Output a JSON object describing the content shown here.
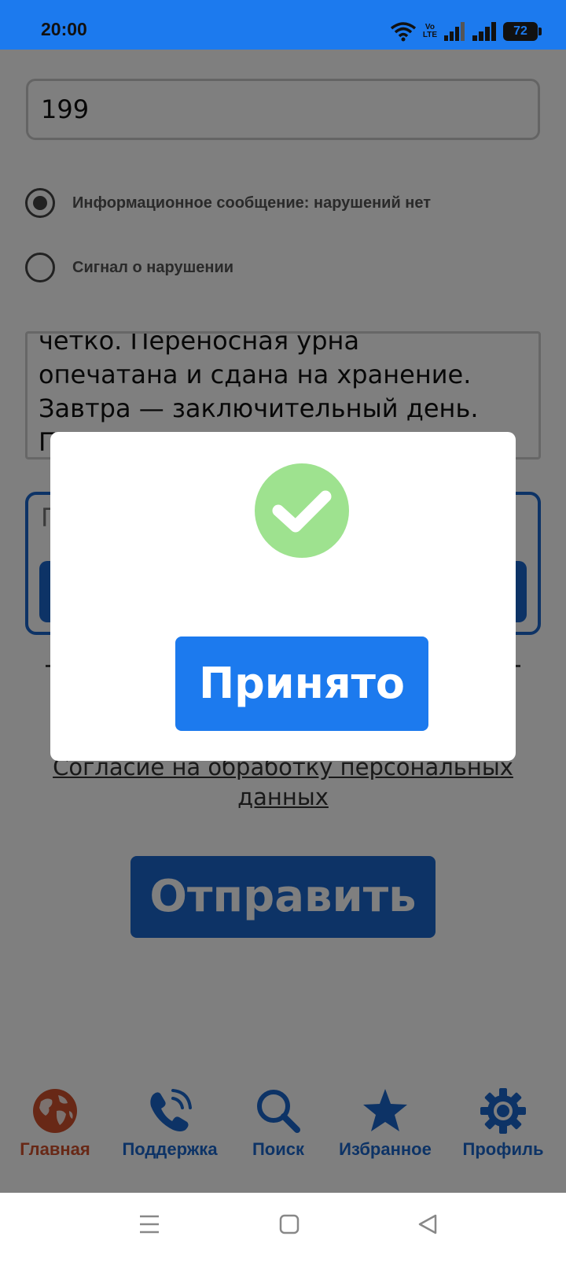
{
  "status_bar": {
    "time": "20:00",
    "network_label_top": "Vo",
    "network_label_bottom": "LTE",
    "battery": "72",
    "icons": [
      "wifi-icon",
      "volte-icon",
      "signal-icon",
      "signal-icon",
      "battery-icon"
    ]
  },
  "form": {
    "number_value": "199",
    "radio_options": [
      {
        "label": "Информационное сообщение: нарушений нет",
        "checked": true
      },
      {
        "label": "Сигнал о нарушении",
        "checked": false
      }
    ],
    "message_lines": [
      "четко. Переносная урна",
      "опечатана и сдана на хранение.",
      "Завтра — заключительный день.",
      "П"
    ],
    "attachment_placeholder": "П",
    "consent_line1": "Согласие на обработку персональных",
    "consent_line2": "данных",
    "submit_label": "Отправить"
  },
  "dialog": {
    "icon": "check-circle-icon",
    "accept_label": "Принято"
  },
  "bottom_nav": {
    "items": [
      {
        "label": "Главная",
        "icon": "globe-icon",
        "active": true
      },
      {
        "label": "Поддержка",
        "icon": "phone-icon",
        "active": false
      },
      {
        "label": "Поиск",
        "icon": "search-icon",
        "active": false
      },
      {
        "label": "Избранное",
        "icon": "star-icon",
        "active": false
      },
      {
        "label": "Профиль",
        "icon": "gear-icon",
        "active": false
      }
    ]
  },
  "colors": {
    "accent": "#1c7aee",
    "primary_button": "#1a66cc",
    "active_nav": "#d1512c",
    "success": "#9ee28f"
  }
}
